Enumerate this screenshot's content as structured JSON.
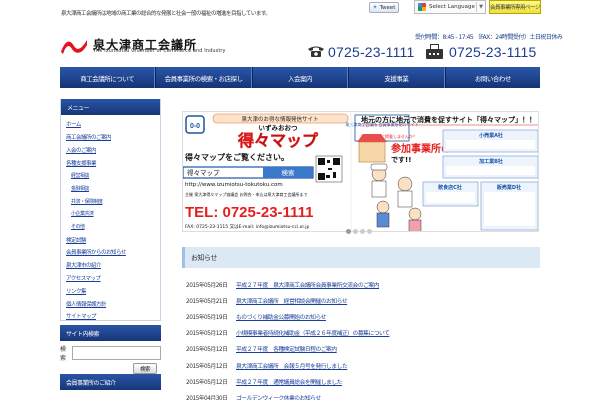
{
  "header": {
    "tagline": "泉大津商工会議所は地域の商工業の総合的な発展と社会一般の福祉の増進を目指しています。",
    "tweet_label": "Tweet",
    "language_label": "Select Language",
    "members_link": "会員事業所専用ページ",
    "logo_jp": "泉大津商工会議所",
    "logo_en": "The Izumiotsu Chamber of Commerce and Industry",
    "hours": "受付時間：8:45 - 17:45 （FAX：24時間受付）土日祝日休み",
    "tel": "0725-23-1111",
    "fax": "0725-23-1115"
  },
  "nav": [
    {
      "label": "商工会議所について"
    },
    {
      "label": "会員事業所の検索・お店探し"
    },
    {
      "label": "入会案内"
    },
    {
      "label": "支援事業"
    },
    {
      "label": "お問い合わせ"
    }
  ],
  "sidebar": {
    "menu_title": "メニュー",
    "items": [
      {
        "label": "ホーム",
        "sub": false
      },
      {
        "label": "商工会議所のご案内",
        "sub": false
      },
      {
        "label": "入会のご案内",
        "sub": false
      },
      {
        "label": "各種支援事業",
        "sub": false
      },
      {
        "label": "経営相談",
        "sub": true
      },
      {
        "label": "金融相談",
        "sub": true
      },
      {
        "label": "共済・保険制度",
        "sub": true
      },
      {
        "label": "小企業共済",
        "sub": true
      },
      {
        "label": "その他",
        "sub": true
      },
      {
        "label": "検定試験",
        "sub": false
      },
      {
        "label": "会員事業所からのお知らせ",
        "sub": false
      },
      {
        "label": "泉大津市の紹介",
        "sub": false
      },
      {
        "label": "アクセスマップ",
        "sub": false
      },
      {
        "label": "リンク集",
        "sub": false
      },
      {
        "label": "個人情報保護方針",
        "sub": false
      },
      {
        "label": "サイトマップ",
        "sub": false
      }
    ],
    "search_title": "サイト内検索",
    "search_label": "検索",
    "search_button": "検索",
    "bottom_title": "会員事業所のご紹介"
  },
  "banner": {
    "left_tag": "泉大津のお得な情報発信サイト",
    "left_brand_small": "いずみおおつ",
    "left_brand": "得々マップ",
    "left_cta": "得々マップをご覧ください。",
    "left_search_text": "得々マップ",
    "left_search_btn": "検索",
    "left_url": "http://www.izumiotsu-tokutoku.com",
    "left_org": "主催 泉大津得々マップ協議会 お問合・申込は泉大津商工会議所まで",
    "left_tel": "TEL: 0725-23-1111",
    "left_fax": "FAX: 0725-23-1115 又はE-mail: info@izumiotsu-cci.or.jp",
    "left_box": "泉大津商工会議所 会員事業所紹介サイト",
    "right_headline": "地元の方に地元で消費を促すサイト「得々マップ」！！",
    "right_sub": "得々マップに掲載しませんか？",
    "right_big": "参加事業所の",
    "right_big2": "です!!",
    "cards": [
      {
        "name": "小売業A社"
      },
      {
        "name": "加工業B社"
      },
      {
        "name": "飲食店C社"
      },
      {
        "name": "販売業D社"
      }
    ]
  },
  "news": {
    "title": "お知らせ",
    "items": [
      {
        "date": "2015年05月26日",
        "title": "平成２７年度　泉大津商工会議所会員事業所交流会のご案内"
      },
      {
        "date": "2015年05月21日",
        "title": "泉大津商工会議所　経営相談会開催のお知らせ"
      },
      {
        "date": "2015年05月19日",
        "title": "ものづくり補助金公募開始のお知らせ"
      },
      {
        "date": "2015年05月12日",
        "title": "小規模事業者持続化補助金（平成２６年度補正）の募集について"
      },
      {
        "date": "2015年05月12日",
        "title": "平成２７年度　各種検定試験日程のご案内"
      },
      {
        "date": "2015年05月12日",
        "title": "泉大津商工会議所　会報５月号を発行しました"
      },
      {
        "date": "2015年05月12日",
        "title": "平成２７年度　通常議員総会を開催しました"
      },
      {
        "date": "2015年04月30日",
        "title": "ゴールデンウィーク休業のお知らせ"
      }
    ]
  },
  "colors": {
    "nav_blue": "#1b3c82",
    "logo_red": "#e3121e",
    "banner_red": "#e51f1f",
    "banner_blue": "#1a56a8",
    "link_blue": "#1a3f9a"
  }
}
